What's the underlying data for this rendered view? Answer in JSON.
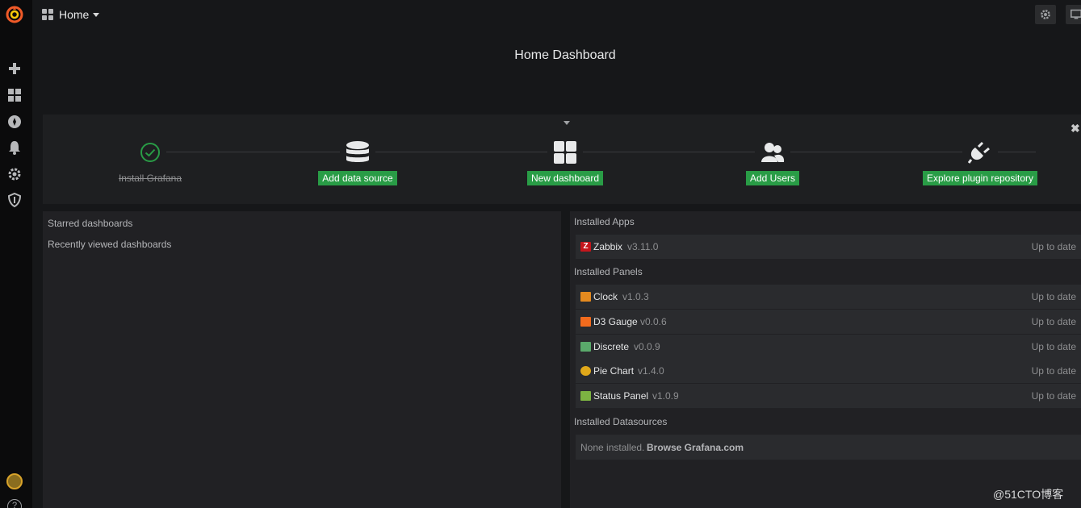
{
  "sidebar": {
    "icons": [
      "grafana-logo-icon",
      "plus-icon",
      "dashboards-icon",
      "explore-compass-icon",
      "bell-icon",
      "gear-icon",
      "shield-icon",
      "user-avatar",
      "help-icon"
    ],
    "help_glyph": "?"
  },
  "navbar": {
    "home_label": "Home",
    "buttons": [
      "gear-icon",
      "monitor-icon"
    ]
  },
  "dashboard": {
    "title": "Home Dashboard"
  },
  "getting_started": {
    "steps": [
      {
        "label": "Install Grafana",
        "done": true,
        "icon": "check-circle-icon"
      },
      {
        "label": "Add data source",
        "done": false,
        "icon": "database-icon"
      },
      {
        "label": "New dashboard",
        "done": false,
        "icon": "dashboard-grid-icon"
      },
      {
        "label": "Add Users",
        "done": false,
        "icon": "users-icon"
      },
      {
        "label": "Explore plugin repository",
        "done": false,
        "icon": "plug-icon"
      }
    ],
    "close_glyph": "✖"
  },
  "left_panel": {
    "starred": "Starred dashboards",
    "recent": "Recently viewed dashboards"
  },
  "plugins": {
    "apps_header": "Installed Apps",
    "apps": [
      {
        "name": "Zabbix",
        "version": "v3.11.0",
        "status": "Up to date",
        "icon_color": "#c4161c"
      }
    ],
    "panels_header": "Installed Panels",
    "panels": [
      {
        "name": "Clock",
        "version": "v1.0.3",
        "status": "Up to date",
        "icon_color": "#e58a1f"
      },
      {
        "name": "D3 Gauge",
        "version": "v0.0.6",
        "status": "Up to date",
        "icon_color": "#f26b1d"
      },
      {
        "name": "Discrete",
        "version": "v0.0.9",
        "status": "Up to date",
        "icon_color": "#5aa96b"
      },
      {
        "name": "Pie Chart",
        "version": "v1.4.0",
        "status": "Up to date",
        "icon_color": "#e0a81a"
      },
      {
        "name": "Status Panel",
        "version": "v1.0.9",
        "status": "Up to date",
        "icon_color": "#7cb342"
      }
    ],
    "datasources_header": "Installed Datasources",
    "none_text": "None installed.",
    "browse_link": "Browse Grafana.com"
  },
  "colors": {
    "accent_green": "#299c46",
    "background": "#161719",
    "panel": "#212124"
  },
  "watermark": "@51CTO博客"
}
